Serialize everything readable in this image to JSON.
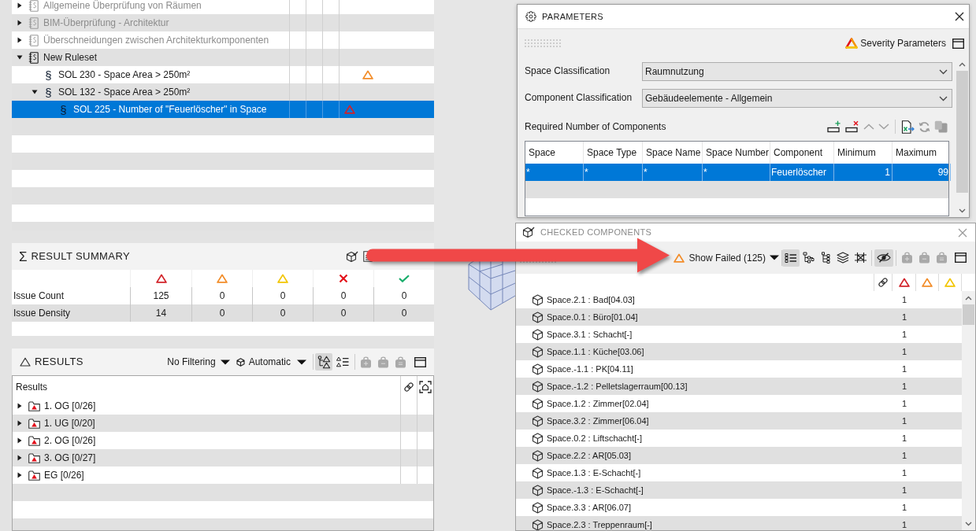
{
  "ruleset_tree": {
    "items": [
      {
        "kind": "ruleset",
        "label": "Allgemeine Überprüfung von Räumen",
        "disabled": true,
        "expanded": false,
        "selected": false
      },
      {
        "kind": "ruleset",
        "label": "BIM-Überprüfung - Architektur",
        "disabled": true,
        "expanded": false,
        "selected": false
      },
      {
        "kind": "ruleset",
        "label": "Überschneidungen zwischen Architekturkomponenten",
        "disabled": true,
        "expanded": false,
        "selected": false
      },
      {
        "kind": "ruleset",
        "label": "New Ruleset",
        "disabled": false,
        "expanded": true,
        "selected": false,
        "children": [
          {
            "kind": "rule",
            "marker": "§",
            "label": "SOL 230 - Space Area > 250m²",
            "disabled": false,
            "selected": false,
            "color": "#f28c28"
          },
          {
            "kind": "rule",
            "marker": "§",
            "label": "SOL 132 - Space Area > 250m²",
            "disabled": false,
            "expanded": true,
            "selected": false,
            "children": [
              {
                "kind": "rule",
                "marker": "§",
                "label": "SOL 225 - Number of \"Feuerlöscher\" in Space",
                "disabled": false,
                "selected": true,
                "color": "#d2232a"
              }
            ]
          }
        ]
      }
    ]
  },
  "result_summary": {
    "symbol": "Σ",
    "title": "RESULT SUMMARY",
    "rows": [
      {
        "label": "Issue Count",
        "values": [
          "125",
          "0",
          "0",
          "0",
          "0"
        ]
      },
      {
        "label": "Issue Density",
        "values": [
          "14",
          "0",
          "0",
          "0",
          "0"
        ]
      }
    ]
  },
  "results": {
    "title": "RESULTS",
    "filter": "No Filtering",
    "mode": "Automatic",
    "view_modes": [
      {
        "kind": "severity-tree",
        "selected": true
      },
      {
        "kind": "severity-list",
        "selected": false
      }
    ],
    "group_actions": [
      {
        "kind": "add",
        "disabled": true
      },
      {
        "kind": "remove",
        "disabled": true
      },
      {
        "kind": "edit",
        "disabled": true
      }
    ],
    "column": "Results",
    "rows": [
      {
        "label": "1. OG [0/26]",
        "expanded": false,
        "selected": false
      },
      {
        "label": "1. UG [0/20]",
        "expanded": false,
        "selected": false
      },
      {
        "label": "2. OG [0/26]",
        "expanded": false,
        "selected": false
      },
      {
        "label": "3. OG [0/27]",
        "expanded": false,
        "selected": false
      },
      {
        "label": "EG [0/26]",
        "expanded": false,
        "selected": false
      }
    ]
  },
  "parameters": {
    "title": "PARAMETERS",
    "focused": true,
    "severity_link": "Severity Parameters",
    "fields": [
      {
        "label": "Space Classification",
        "value": "Raumnutzung"
      },
      {
        "label": "Component Classification",
        "value": "Gebäudeelemente - Allgemein"
      }
    ],
    "section": "Required Number of Components",
    "row_actions": [
      {
        "kind": "add-row",
        "disabled": false
      },
      {
        "kind": "delete-row",
        "disabled": false
      },
      {
        "kind": "move-up",
        "disabled": true
      },
      {
        "kind": "move-down",
        "disabled": true
      },
      {
        "kind": "export",
        "disabled": false
      },
      {
        "kind": "refresh",
        "disabled": true
      },
      {
        "kind": "paste",
        "disabled": true
      }
    ],
    "table": {
      "columns": [
        {
          "label": "Space",
          "kind": "text"
        },
        {
          "label": "Space Type",
          "kind": "text"
        },
        {
          "label": "Space Name",
          "kind": "text"
        },
        {
          "label": "Space Number",
          "kind": "text"
        },
        {
          "label": "Component",
          "kind": "text"
        },
        {
          "label": "Minimum",
          "kind": "number"
        },
        {
          "label": "Maximum",
          "kind": "number"
        }
      ],
      "rows": [
        {
          "cells": [
            "*",
            "*",
            "*",
            "*",
            "Feuerlöscher",
            "1",
            "99"
          ],
          "selected": true
        }
      ]
    }
  },
  "checked_components": {
    "title": "CHECKED COMPONENTS",
    "focused": false,
    "filter": "Show Failed (125)",
    "view_modes": [
      {
        "kind": "list",
        "selected": true
      },
      {
        "kind": "tree",
        "selected": false
      },
      {
        "kind": "hierarchy",
        "selected": false
      },
      {
        "kind": "layers",
        "selected": false
      },
      {
        "kind": "network",
        "selected": false
      }
    ],
    "visibility_toggle": {
      "on": true
    },
    "group_actions": [
      {
        "kind": "add",
        "disabled": true
      },
      {
        "kind": "remove",
        "disabled": true
      },
      {
        "kind": "edit",
        "disabled": true
      }
    ],
    "rows": [
      {
        "label": "Space.2.1 : Bad[04.03]",
        "count": "1",
        "selected": false
      },
      {
        "label": "Space.0.1 : Büro[01.04]",
        "count": "1",
        "selected": false
      },
      {
        "label": "Space.3.1 : Schacht[-]",
        "count": "1",
        "selected": false
      },
      {
        "label": "Space.1.1 : Küche[03.06]",
        "count": "1",
        "selected": false
      },
      {
        "label": "Space.-1.1 : PK[04.11]",
        "count": "1",
        "selected": false
      },
      {
        "label": "Space.-1.2 : Pelletslagerraum[00.13]",
        "count": "1",
        "selected": false
      },
      {
        "label": "Space.1.2 : Zimmer[02.04]",
        "count": "1",
        "selected": false
      },
      {
        "label": "Space.3.2 : Zimmer[06.04]",
        "count": "1",
        "selected": false
      },
      {
        "label": "Space.0.2 : Liftschacht[-]",
        "count": "1",
        "selected": false
      },
      {
        "label": "Space.2.2 : AR[05.03]",
        "count": "1",
        "selected": false
      },
      {
        "label": "Space.1.3 : E-Schacht[-]",
        "count": "1",
        "selected": false
      },
      {
        "label": "Space.-1.3 : E-Schacht[-]",
        "count": "1",
        "selected": false
      },
      {
        "label": "Space.3.3 : AR[06.07]",
        "count": "1",
        "selected": false
      },
      {
        "label": "Space.2.3 : Treppenraum[-]",
        "count": "1",
        "selected": false
      }
    ]
  }
}
